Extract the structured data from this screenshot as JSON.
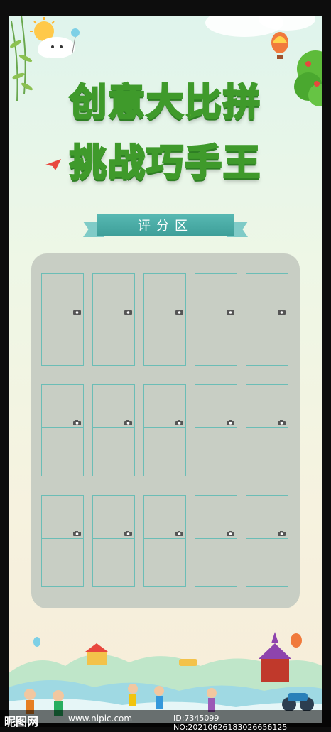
{
  "title": {
    "line1": "创意大比拼",
    "line2": "挑战巧手王"
  },
  "section": {
    "label": "评分区"
  },
  "grid": {
    "rows": 3,
    "cols": 5,
    "icon": "camera-icon"
  },
  "colors": {
    "title_fill": "#a6e34a",
    "title_stroke": "#3f9a2b",
    "ribbon": "#4aa9a3",
    "panel": "#c8cec4",
    "cell_border": "#6bbdb6"
  },
  "watermark": {
    "logo": "昵图网",
    "url": "www.nipic.com",
    "id": "ID:7345099 NO:20210626183026656125"
  }
}
